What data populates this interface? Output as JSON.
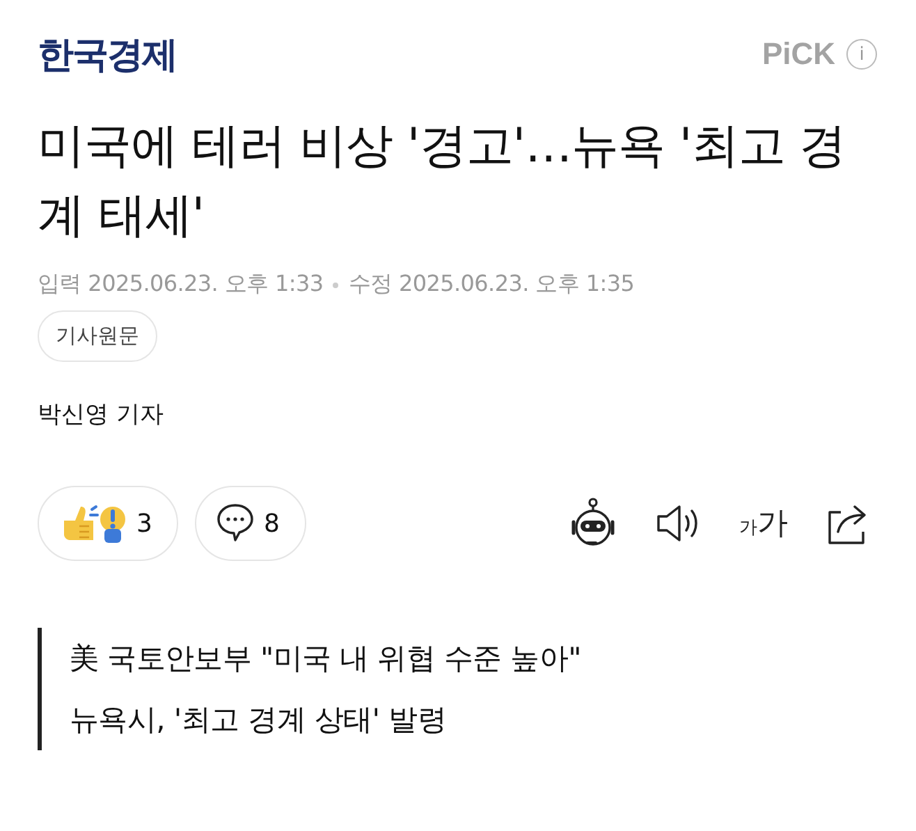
{
  "header": {
    "publisher": "한국경제",
    "pick_label": "PiCK",
    "info_label": "i"
  },
  "headline": "미국에 테러 비상 '경고'…뉴욕 '최고 경계 태세'",
  "meta": {
    "published": "입력 2025.06.23. 오후 1:33",
    "modified": "수정 2025.06.23. 오후 1:35"
  },
  "original_link": "기사원문",
  "byline": "박신영 기자",
  "actions": {
    "reactions": "3",
    "comments": "8",
    "font_small": "가",
    "font_large": "가"
  },
  "subheadlines": [
    "美 국토안보부 \"미국 내 위협 수준 높아\"",
    "뉴욕시, '최고 경계 상태' 발령"
  ]
}
